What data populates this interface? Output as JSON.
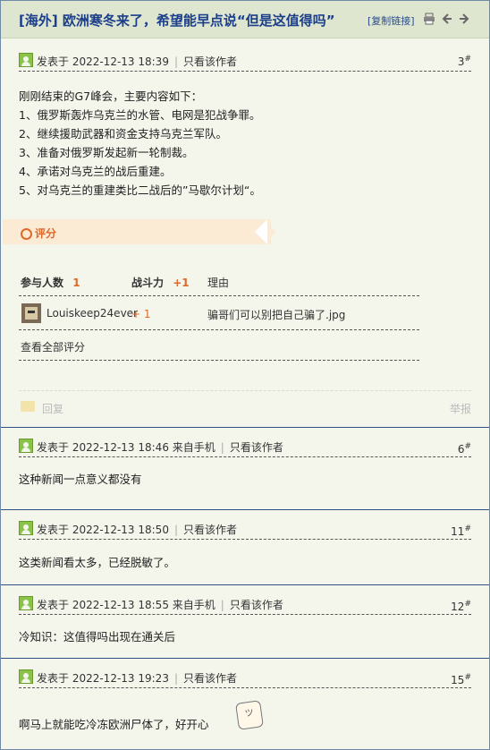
{
  "title": "[海外] 欧洲寒冬来了，希望能早点说“但是这值得吗”",
  "copy_link": "[复制链接]",
  "toolbar_icons": [
    "print-icon",
    "prev-icon",
    "next-icon"
  ],
  "posts": [
    {
      "meta": "发表于 2022-12-13 18:39",
      "only_author": "只看该作者",
      "floor": "3",
      "floor_sup": "#",
      "lines": [
        "刚刚结束的G7峰会，主要内容如下：",
        "1、俄罗斯轰炸乌克兰的水管、电网是犯战争罪。",
        "2、继续援助武器和资金支持乌克兰军队。",
        "3、准备对俄罗斯发起新一轮制裁。",
        "4、承诺对乌克兰的战后重建。",
        "5、对乌克兰的重建类比二战后的”马歇尔计划“。"
      ],
      "rating": {
        "label": "评分",
        "col_participants": "参与人数",
        "participants_count": "1",
        "col_power": "战斗力",
        "power_total": "+1",
        "col_reason": "理由",
        "rows": [
          {
            "user": "Louiskeep24ever",
            "power": "+ 1",
            "reason": "骗哥们可以别把自己骗了.jpg"
          }
        ],
        "view_all": "查看全部评分"
      },
      "reply": "回复",
      "report": "举报"
    },
    {
      "meta": "发表于 2022-12-13 18:46 来自手机",
      "only_author": "只看该作者",
      "floor": "6",
      "floor_sup": "#",
      "text": "这种新闻一点意义都没有"
    },
    {
      "meta": "发表于 2022-12-13 18:50",
      "only_author": "只看该作者",
      "floor": "11",
      "floor_sup": "#",
      "text": "这类新闻看太多，已经脱敏了。"
    },
    {
      "meta": "发表于 2022-12-13 18:55 来自手机",
      "only_author": "只看该作者",
      "floor": "12",
      "floor_sup": "#",
      "text": "冷知识：这值得吗出现在通关后"
    },
    {
      "meta": "发表于 2022-12-13 19:23",
      "only_author": "只看该作者",
      "floor": "15",
      "floor_sup": "#",
      "text": "啊马上就能吃冷冻欧洲尸体了，好开心"
    }
  ]
}
